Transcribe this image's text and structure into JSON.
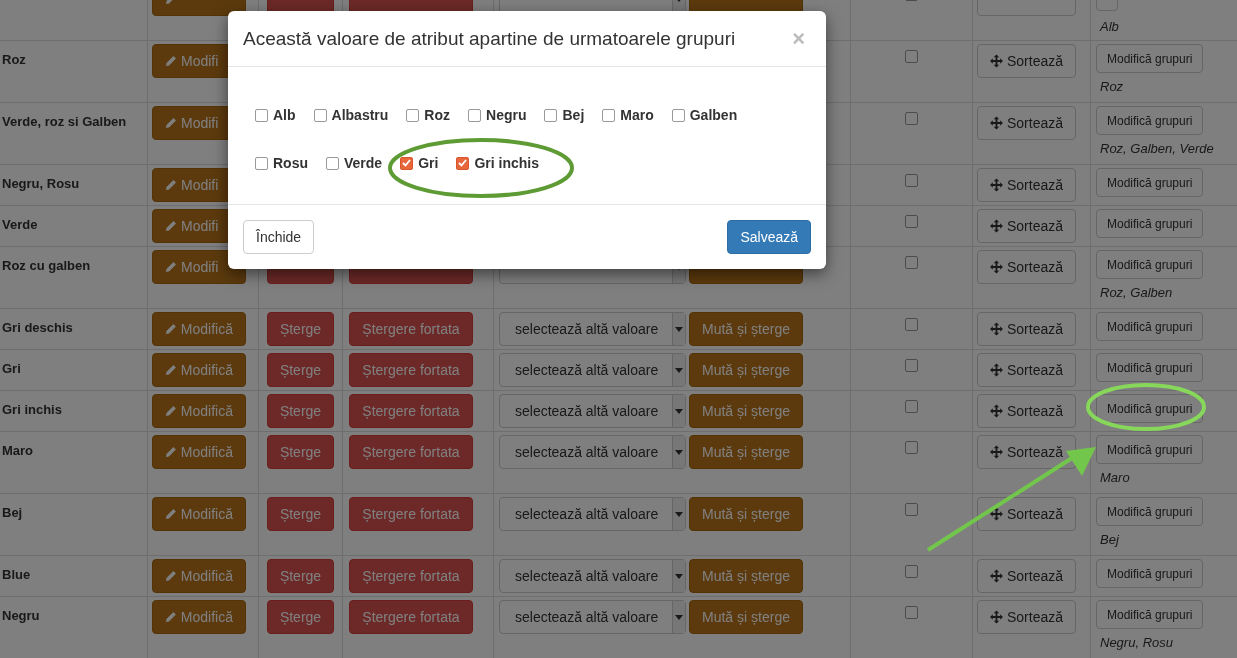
{
  "table": {
    "rows": [
      {
        "checked": false,
        "groups": "Alb"
      },
      {
        "name": "Roz",
        "edit": "Modifi",
        "checked": false,
        "sort": "Sortează",
        "edit_groups": "Modifică grupuri",
        "groups": "Roz"
      },
      {
        "name": "Verde, roz si Galben",
        "edit": "Modifi",
        "checked": false,
        "sort": "Sortează",
        "edit_groups": "Modifică grupuri",
        "groups": "Roz, Galben, Verde"
      },
      {
        "name": "Negru, Rosu",
        "edit": "Modifi",
        "checked": false,
        "sort": "Sortează",
        "edit_groups": "Modifică grupuri"
      },
      {
        "name": "Verde",
        "edit": "Modifi",
        "checked": false,
        "sort": "Sortează",
        "edit_groups": "Modifică grupuri"
      },
      {
        "name": "Roz cu galben",
        "edit": "Modifi",
        "checked": false,
        "sort": "Sortează",
        "edit_groups": "Modifică grupuri",
        "groups": "Roz, Galben"
      },
      {
        "name": "Gri deschis",
        "edit": "Modifică",
        "delete": "Șterge",
        "force_delete": "Ștergere fortata",
        "replace_select": "selectează altă valoare",
        "move_delete": "Mută și șterge",
        "checked": false,
        "sort": "Sortează",
        "edit_groups": "Modifică grupuri"
      },
      {
        "name": "Gri",
        "edit": "Modifică",
        "delete": "Șterge",
        "force_delete": "Ștergere fortata",
        "replace_select": "selectează altă valoare",
        "move_delete": "Mută și șterge",
        "checked": false,
        "sort": "Sortează",
        "edit_groups": "Modifică grupuri"
      },
      {
        "name": "Gri inchis",
        "edit": "Modifică",
        "delete": "Șterge",
        "force_delete": "Ștergere fortata",
        "replace_select": "selectează altă valoare",
        "move_delete": "Mută și șterge",
        "checked": false,
        "sort": "Sortează",
        "edit_groups": "Modifică grupuri"
      },
      {
        "name": "Maro",
        "edit": "Modifică",
        "delete": "Șterge",
        "force_delete": "Ștergere fortata",
        "replace_select": "selectează altă valoare",
        "move_delete": "Mută și șterge",
        "checked": false,
        "sort": "Sortează",
        "edit_groups": "Modifică grupuri",
        "groups": "Maro"
      },
      {
        "name": "Bej",
        "edit": "Modifică",
        "delete": "Șterge",
        "force_delete": "Ștergere fortata",
        "replace_select": "selectează altă valoare",
        "move_delete": "Mută și șterge",
        "checked": false,
        "sort": "Sortează",
        "edit_groups": "Modifică grupuri",
        "groups": "Bej"
      },
      {
        "name": "Blue",
        "edit": "Modifică",
        "delete": "Șterge",
        "force_delete": "Ștergere fortata",
        "replace_select": "selectează altă valoare",
        "move_delete": "Mută și șterge",
        "checked": false,
        "sort": "Sortează",
        "edit_groups": "Modifică grupuri"
      },
      {
        "name": "Negru",
        "edit": "Modifică",
        "delete": "Șterge",
        "force_delete": "Ștergere fortata",
        "replace_select": "selectează altă valoare",
        "move_delete": "Mută și șterge",
        "checked": false,
        "sort": "Sortează",
        "edit_groups": "Modifică grupuri",
        "groups": "Negru, Rosu"
      }
    ]
  },
  "modal": {
    "title": "Această valoare de atribut apartine de urmatoarele grupuri",
    "close": "×",
    "options": [
      {
        "label": "Alb",
        "checked": false
      },
      {
        "label": "Albastru",
        "checked": false
      },
      {
        "label": "Roz",
        "checked": false
      },
      {
        "label": "Negru",
        "checked": false
      },
      {
        "label": "Bej",
        "checked": false
      },
      {
        "label": "Maro",
        "checked": false
      },
      {
        "label": "Galben",
        "checked": false
      },
      {
        "label": "Rosu",
        "checked": false
      },
      {
        "label": "Verde",
        "checked": false
      },
      {
        "label": "Gri",
        "checked": true
      },
      {
        "label": "Gri inchis",
        "checked": true
      }
    ],
    "buttons": [
      {
        "kind": "default",
        "label": "Închide"
      },
      {
        "kind": "primary",
        "label": "Salvează"
      }
    ]
  }
}
